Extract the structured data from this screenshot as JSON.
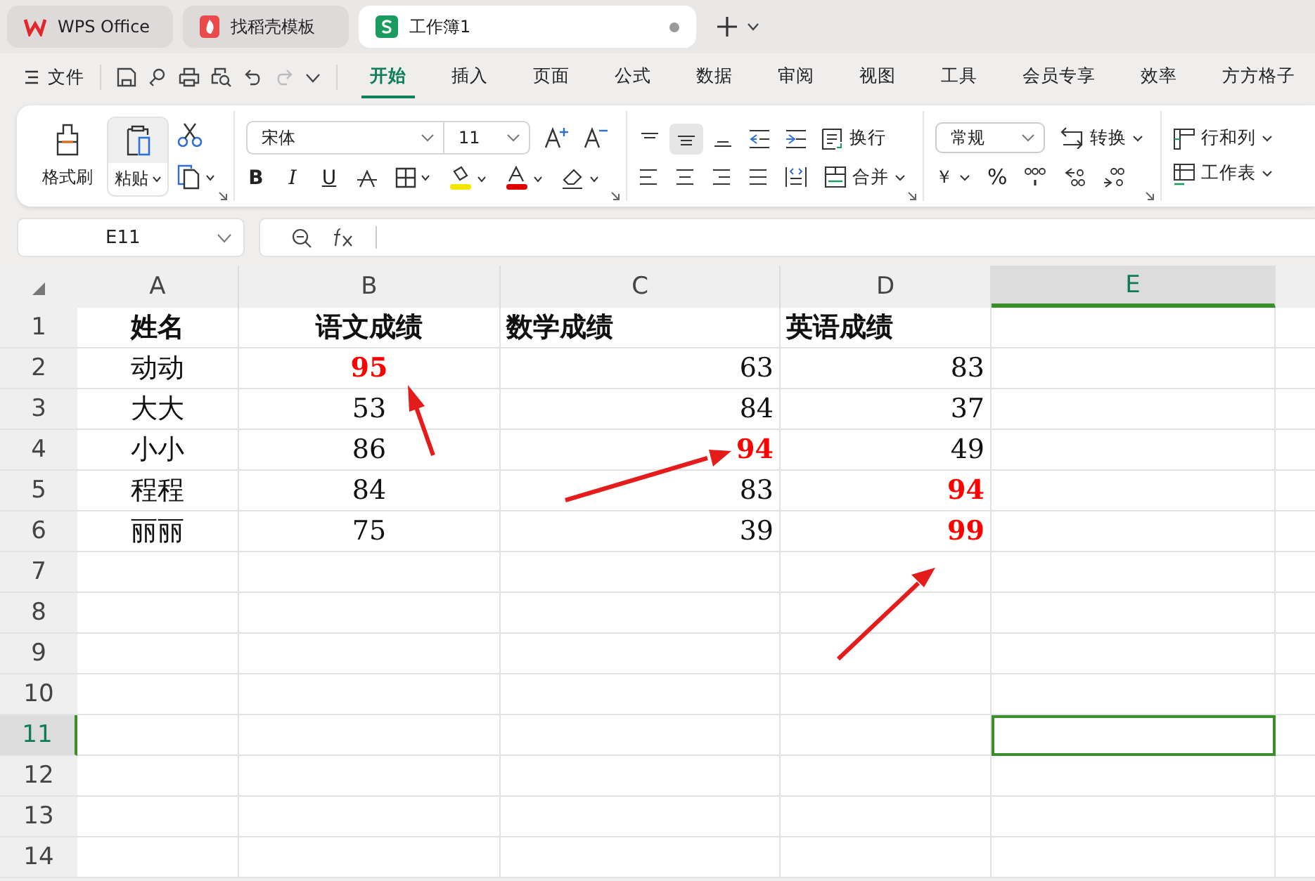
{
  "title_tabs": [
    {
      "label": "WPS Office",
      "kind": "wps",
      "selected": false
    },
    {
      "label": "找稻壳模板",
      "kind": "docer",
      "selected": false
    },
    {
      "label": "工作簿1",
      "kind": "sheet",
      "selected": true
    }
  ],
  "menu": {
    "file": "文件",
    "tabs": [
      {
        "label": "开始",
        "selected": true
      },
      {
        "label": "插入",
        "selected": false
      },
      {
        "label": "页面",
        "selected": false
      },
      {
        "label": "公式",
        "selected": false
      },
      {
        "label": "数据",
        "selected": false
      },
      {
        "label": "审阅",
        "selected": false
      },
      {
        "label": "视图",
        "selected": false
      },
      {
        "label": "工具",
        "selected": false
      },
      {
        "label": "会员专享",
        "selected": false
      },
      {
        "label": "效率",
        "selected": false
      },
      {
        "label": "方方格子",
        "selected": false
      }
    ]
  },
  "ribbon": {
    "format_painter": "格式刷",
    "paste": "粘贴",
    "font": "宋体",
    "font_size": "11",
    "bold": "B",
    "italic": "I",
    "underline": "U",
    "vertical_align": [
      {
        "selected": false
      },
      {
        "selected": true
      },
      {
        "selected": false
      }
    ],
    "wrap": "换行",
    "merge": "合并",
    "number_format": "常规",
    "convert": "转换",
    "currency": "￥",
    "percent": "%",
    "rows_cols": "行和列",
    "worksheet": "工作表"
  },
  "formula_bar": {
    "name_box": "E11"
  },
  "sheet": {
    "columns": [
      {
        "label": "A",
        "selected": false
      },
      {
        "label": "B",
        "selected": false
      },
      {
        "label": "C",
        "selected": false
      },
      {
        "label": "D",
        "selected": false
      },
      {
        "label": "E",
        "selected": true
      }
    ],
    "rows": [
      {
        "number": "1",
        "selected": false,
        "cells": [
          {
            "text": "姓名",
            "highlight": false
          },
          {
            "text": "语文成绩",
            "highlight": false
          },
          {
            "text": "数学成绩",
            "highlight": false
          },
          {
            "text": "英语成绩",
            "highlight": false
          }
        ]
      },
      {
        "number": "2",
        "selected": false,
        "cells": [
          {
            "text": "动动",
            "highlight": false
          },
          {
            "text": "95",
            "highlight": true
          },
          {
            "text": "63",
            "highlight": false
          },
          {
            "text": "83",
            "highlight": false
          }
        ]
      },
      {
        "number": "3",
        "selected": false,
        "cells": [
          {
            "text": "大大",
            "highlight": false
          },
          {
            "text": "53",
            "highlight": false
          },
          {
            "text": "84",
            "highlight": false
          },
          {
            "text": "37",
            "highlight": false
          }
        ]
      },
      {
        "number": "4",
        "selected": false,
        "cells": [
          {
            "text": "小小",
            "highlight": false
          },
          {
            "text": "86",
            "highlight": false
          },
          {
            "text": "94",
            "highlight": true
          },
          {
            "text": "49",
            "highlight": false
          }
        ]
      },
      {
        "number": "5",
        "selected": false,
        "cells": [
          {
            "text": "程程",
            "highlight": false
          },
          {
            "text": "84",
            "highlight": false
          },
          {
            "text": "83",
            "highlight": false
          },
          {
            "text": "94",
            "highlight": true
          }
        ]
      },
      {
        "number": "6",
        "selected": false,
        "cells": [
          {
            "text": "丽丽",
            "highlight": false
          },
          {
            "text": "75",
            "highlight": false
          },
          {
            "text": "39",
            "highlight": false
          },
          {
            "text": "99",
            "highlight": true
          }
        ]
      },
      {
        "number": "7",
        "selected": false
      },
      {
        "number": "8",
        "selected": false
      },
      {
        "number": "9",
        "selected": false
      },
      {
        "number": "10",
        "selected": false
      },
      {
        "number": "11",
        "selected": true
      },
      {
        "number": "12",
        "selected": false
      },
      {
        "number": "13",
        "selected": false
      },
      {
        "number": "14",
        "selected": false
      }
    ]
  }
}
